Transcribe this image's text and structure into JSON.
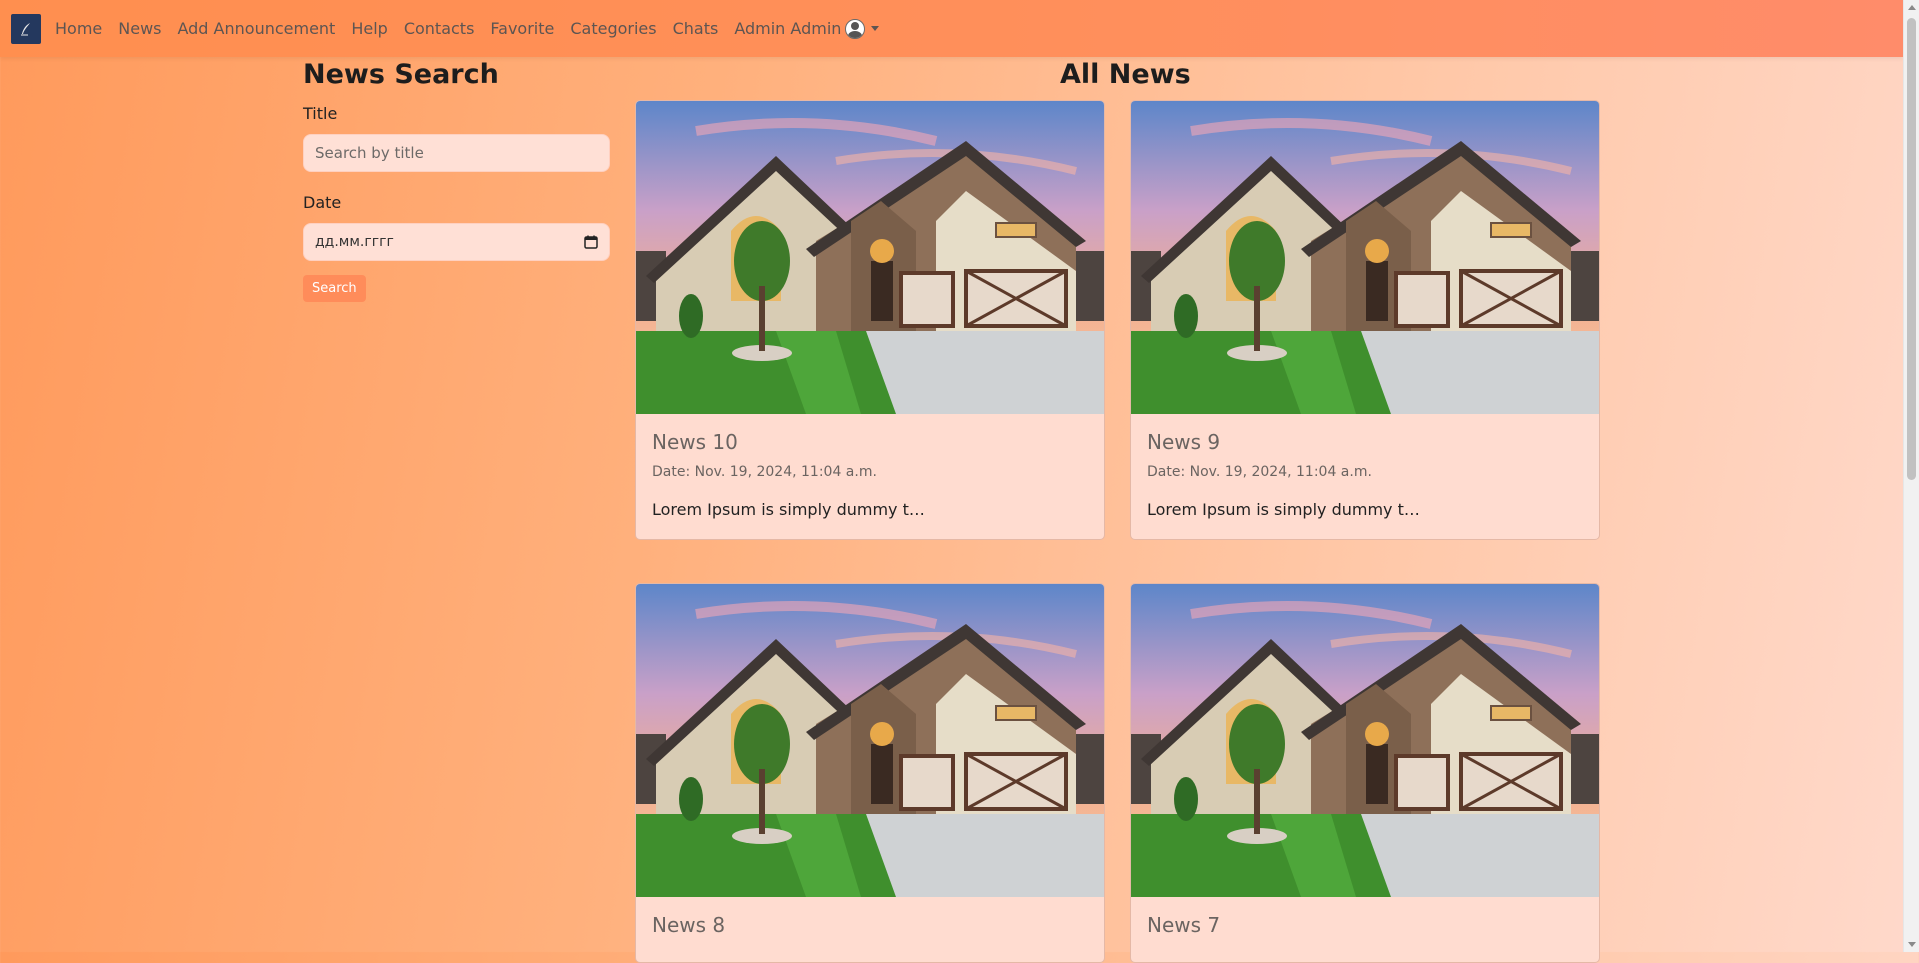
{
  "nav": {
    "items": [
      {
        "label": "Home",
        "name": "nav-home"
      },
      {
        "label": "News",
        "name": "nav-news"
      },
      {
        "label": "Add Announcement",
        "name": "nav-add-announcement"
      },
      {
        "label": "Help",
        "name": "nav-help"
      },
      {
        "label": "Contacts",
        "name": "nav-contacts"
      },
      {
        "label": "Favorite",
        "name": "nav-favorite"
      },
      {
        "label": "Categories",
        "name": "nav-categories"
      },
      {
        "label": "Chats",
        "name": "nav-chats"
      }
    ],
    "user_label": "Admin Admin"
  },
  "search": {
    "heading": "News Search",
    "title_label": "Title",
    "title_placeholder": "Search by title",
    "date_label": "Date",
    "date_placeholder": "дд.мм.гггг",
    "button_label": "Search"
  },
  "news": {
    "heading": "All News",
    "items": [
      {
        "title": "News 10",
        "date": "Date: Nov. 19, 2024, 11:04 a.m.",
        "excerpt": "Lorem Ipsum is simply dummy t…"
      },
      {
        "title": "News 9",
        "date": "Date: Nov. 19, 2024, 11:04 a.m.",
        "excerpt": "Lorem Ipsum is simply dummy t…"
      },
      {
        "title": "News 8",
        "date": "",
        "excerpt": ""
      },
      {
        "title": "News 7",
        "date": "",
        "excerpt": ""
      }
    ]
  },
  "colors": {
    "navbar": "#ff8f4f",
    "accent": "#ff8c5a",
    "card_bg": "#ffdcd0",
    "brand": "#24385e"
  }
}
